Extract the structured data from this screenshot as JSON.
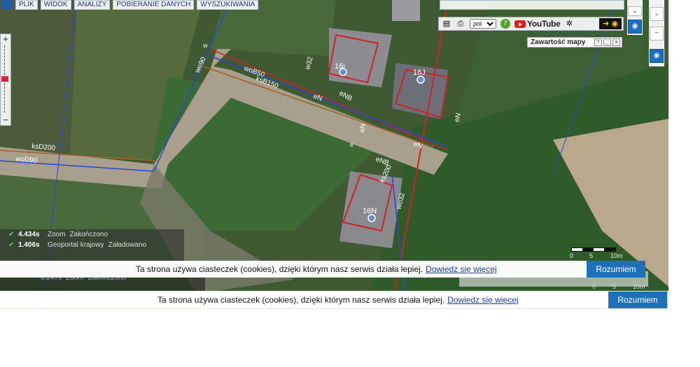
{
  "menu": {
    "items": [
      "PLIK",
      "WIDOK",
      "ANALIZY",
      "POBIERANIE DANYCH",
      "WYSZUKIWANIA"
    ]
  },
  "toolbar": {
    "language": "pol",
    "youtube_label": "YouTube",
    "icons": [
      "legend-icon",
      "print-icon",
      "help-icon",
      "share-icon",
      "eye-icon"
    ]
  },
  "contents_panel": {
    "title": "Zawartość mapy",
    "controls": [
      "?",
      "_",
      "x"
    ]
  },
  "map": {
    "parcels": [
      "16i",
      "16J",
      "16N"
    ],
    "labels": {
      "wo90": "wo90",
      "woB50": "woB50",
      "ksB150": "ksB150",
      "eN1": "eN",
      "eNB1": "eNB",
      "eN2": "eN",
      "eN3": "eN",
      "eN4": "eN",
      "eNB2": "eNB",
      "ks200": "ks200",
      "wo32": "wo32",
      "w32": "w32",
      "ksD200": "ksD200",
      "woD90": "woD90",
      "w": "w",
      "e": "e"
    }
  },
  "status_log": [
    {
      "time": "4.434s",
      "action": "Zoom",
      "status": "Zakończono"
    },
    {
      "time": "1.406s",
      "action": "Geoportal krajowy",
      "status": "Załadowano"
    }
  ],
  "rear_log": {
    "time": "0.247s",
    "action": "Zoom",
    "status": "Zakończono"
  },
  "scale": {
    "labels": [
      "0",
      "5",
      "10m"
    ]
  },
  "cookie": {
    "message": "Ta strona używa ciasteczek (cookies), dzięki którym nasz serwis działa lepiej.",
    "link": "Dowiedz się więcej",
    "button": "Rozumiem"
  },
  "colors": {
    "accent": "#1d71b8",
    "parcel_red": "#d0202a",
    "line_blue": "#2448d8",
    "line_orange": "#a0602a"
  }
}
